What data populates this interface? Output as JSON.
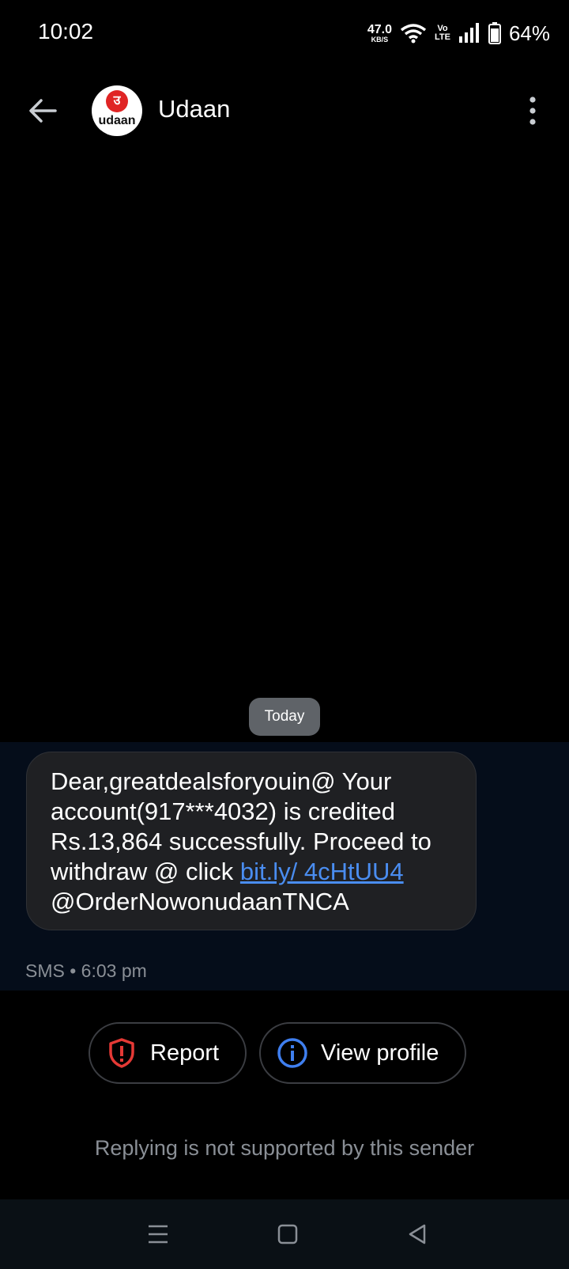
{
  "status_bar": {
    "time": "10:02",
    "net_speed_value": "47.0",
    "net_speed_unit": "KB/S",
    "volte_top": "Vo",
    "volte_bottom": "LTE",
    "battery": "64%"
  },
  "header": {
    "contact_name": "Udaan",
    "avatar_glyph": "उ",
    "avatar_word": "udaan"
  },
  "conversation": {
    "date_chip": "Today",
    "message": {
      "text_before_link": "Dear,greatdealsforyouin@ Your account(917***4032) is credited Rs.13,864 successfully. Proceed to withdraw @ click ",
      "link_text": "bit.ly/ 4cHtUU4",
      "text_after_link": "@OrderNowonudaanTNCA",
      "meta": "SMS • 6:03 pm"
    }
  },
  "actions": {
    "report_label": "Report",
    "view_profile_label": "View profile"
  },
  "footer": {
    "reply_note": "Replying is not supported by this sender"
  },
  "colors": {
    "accent_link": "#4a8df0",
    "report_icon": "#e53935",
    "info_icon": "#3f7ff0"
  }
}
